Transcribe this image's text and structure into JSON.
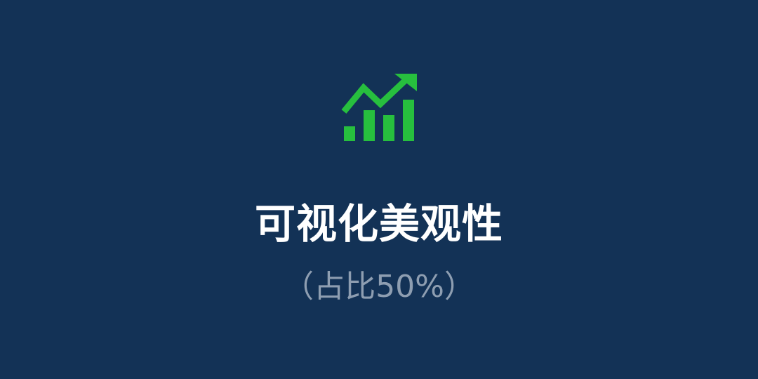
{
  "slide": {
    "title": "可视化美观性",
    "subtitle": "（占比50%）"
  },
  "icon": {
    "name": "trending-up-chart-icon",
    "color": "#27bf3e"
  },
  "colors": {
    "background": "#133256",
    "title": "#ffffff",
    "subtitle": "#8e9eb1"
  }
}
